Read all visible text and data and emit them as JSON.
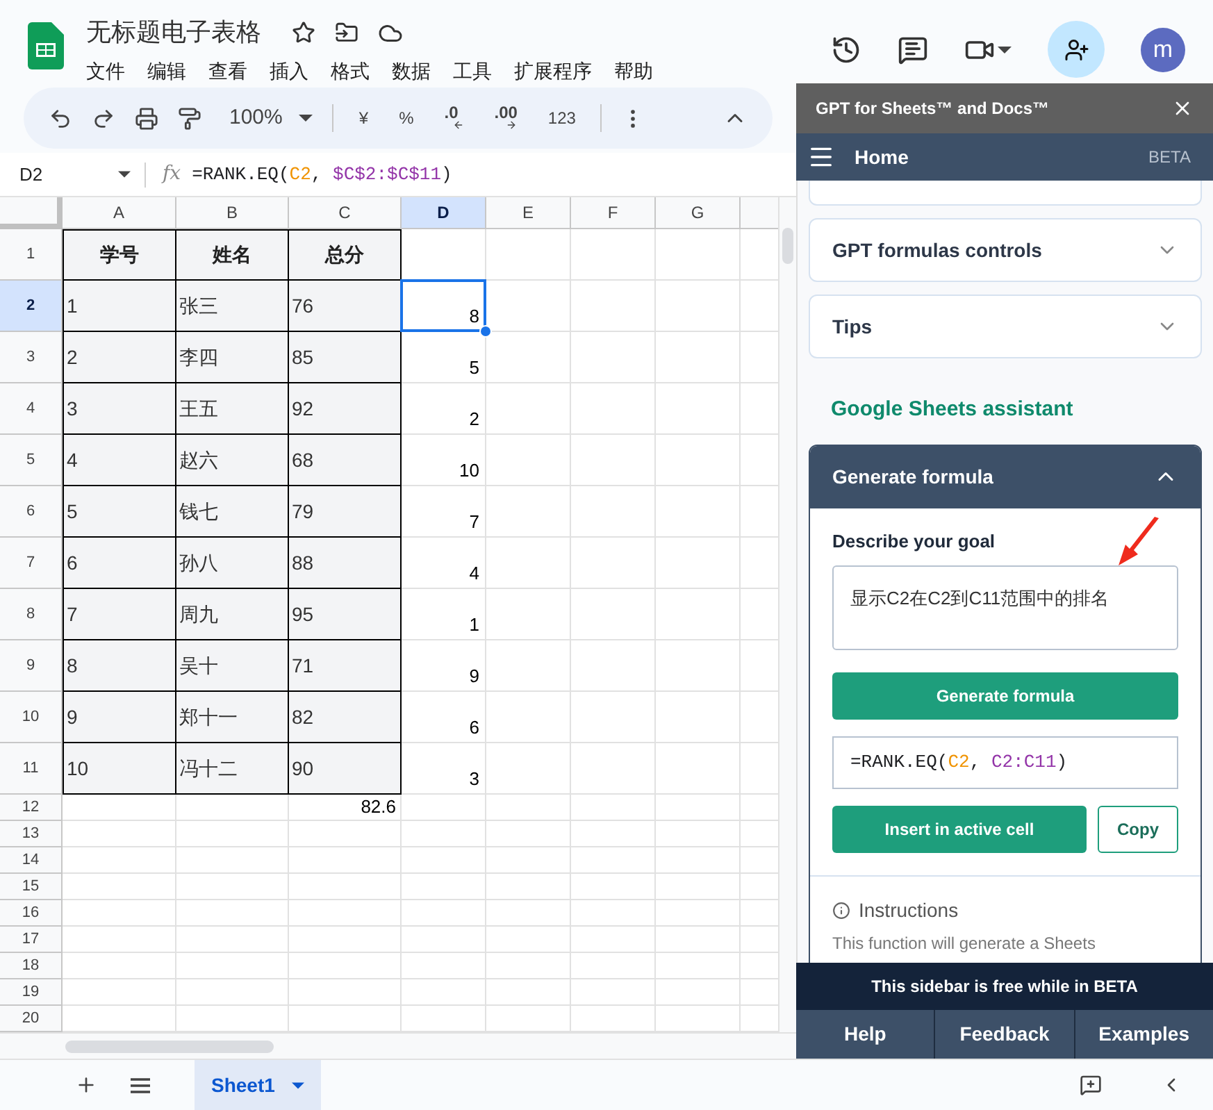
{
  "document": {
    "title": "无标题电子表格",
    "menu": [
      "文件",
      "编辑",
      "查看",
      "插入",
      "格式",
      "数据",
      "工具",
      "扩展程序",
      "帮助"
    ],
    "avatar": "m"
  },
  "toolbar": {
    "zoom": "100%",
    "format_items": [
      {
        "kind": "text",
        "label": "¥"
      },
      {
        "kind": "text",
        "label": "%"
      },
      {
        "kind": "decrease",
        "label": ".0"
      },
      {
        "kind": "increase",
        "label": ".00"
      },
      {
        "kind": "text",
        "label": "123"
      }
    ]
  },
  "formula_bar": {
    "cell_ref": "D2",
    "fx_label": "fx",
    "parts": [
      {
        "text": "=RANK.EQ(",
        "color": "#202124"
      },
      {
        "text": "C2",
        "color": "#f09300"
      },
      {
        "text": ", ",
        "color": "#202124"
      },
      {
        "text": "$C$2:$C$11",
        "color": "#9334a8"
      },
      {
        "text": ")",
        "color": "#202124"
      }
    ]
  },
  "sheet": {
    "columns": [
      {
        "label": "A",
        "selected": false
      },
      {
        "label": "B",
        "selected": false
      },
      {
        "label": "C",
        "selected": false
      },
      {
        "label": "D",
        "selected": true
      },
      {
        "label": "E",
        "selected": false
      },
      {
        "label": "F",
        "selected": false
      },
      {
        "label": "G",
        "selected": false
      }
    ],
    "row_numbers": [
      {
        "label": "1",
        "selected": false
      },
      {
        "label": "2",
        "selected": true
      },
      {
        "label": "3",
        "selected": false
      },
      {
        "label": "4",
        "selected": false
      },
      {
        "label": "5",
        "selected": false
      },
      {
        "label": "6",
        "selected": false
      },
      {
        "label": "7",
        "selected": false
      },
      {
        "label": "8",
        "selected": false
      },
      {
        "label": "9",
        "selected": false
      },
      {
        "label": "10",
        "selected": false
      },
      {
        "label": "11",
        "selected": false
      },
      {
        "label": "12",
        "selected": false
      },
      {
        "label": "13",
        "selected": false
      },
      {
        "label": "14",
        "selected": false
      },
      {
        "label": "15",
        "selected": false
      },
      {
        "label": "16",
        "selected": false
      },
      {
        "label": "17",
        "selected": false
      },
      {
        "label": "18",
        "selected": false
      },
      {
        "label": "19",
        "selected": false
      },
      {
        "label": "20",
        "selected": false
      }
    ],
    "header": [
      "学号",
      "姓名",
      "总分"
    ],
    "rows": [
      {
        "id": "1",
        "name": "张三",
        "score": "76",
        "rank": "8",
        "selected": true
      },
      {
        "id": "2",
        "name": "李四",
        "score": "85",
        "rank": "5",
        "selected": false
      },
      {
        "id": "3",
        "name": "王五",
        "score": "92",
        "rank": "2",
        "selected": false
      },
      {
        "id": "4",
        "name": "赵六",
        "score": "68",
        "rank": "10",
        "selected": false
      },
      {
        "id": "5",
        "name": "钱七",
        "score": "79",
        "rank": "7",
        "selected": false
      },
      {
        "id": "6",
        "name": "孙八",
        "score": "88",
        "rank": "4",
        "selected": false
      },
      {
        "id": "7",
        "name": "周九",
        "score": "95",
        "rank": "1",
        "selected": false
      },
      {
        "id": "8",
        "name": "吴十",
        "score": "71",
        "rank": "9",
        "selected": false
      },
      {
        "id": "9",
        "name": "郑十一",
        "score": "82",
        "rank": "6",
        "selected": false
      },
      {
        "id": "10",
        "name": "冯十二",
        "score": "90",
        "rank": "3",
        "selected": false
      }
    ],
    "average": "82.6"
  },
  "sheet_tabs": [
    {
      "label": "Sheet1",
      "selected": true
    }
  ],
  "sidebar": {
    "title": "GPT for Sheets™ and Docs™",
    "nav_title": "Home",
    "badge": "BETA",
    "cards": [
      {
        "title": "GPT formulas controls",
        "expanded": false
      },
      {
        "title": "Tips",
        "expanded": false
      }
    ],
    "section_title": "Google Sheets assistant",
    "generate": {
      "title": "Generate formula",
      "expanded": true,
      "goal_label": "Describe your goal",
      "goal_value": "显示C2在C2到C11范围中的排名",
      "generate_button": "Generate formula",
      "result_parts": [
        {
          "text": "=RANK.EQ(",
          "color": "#202124"
        },
        {
          "text": "C2",
          "color": "#f09300"
        },
        {
          "text": ", ",
          "color": "#202124"
        },
        {
          "text": "C2:C11",
          "color": "#9334a8"
        },
        {
          "text": ")",
          "color": "#202124"
        }
      ],
      "insert_button": "Insert in active cell",
      "copy_button": "Copy"
    },
    "instructions": {
      "title": "Instructions",
      "text": "This function will generate a Sheets"
    },
    "footer_note": "This sidebar is free while in BETA",
    "footer_buttons": [
      "Help",
      "Feedback",
      "Examples"
    ]
  }
}
